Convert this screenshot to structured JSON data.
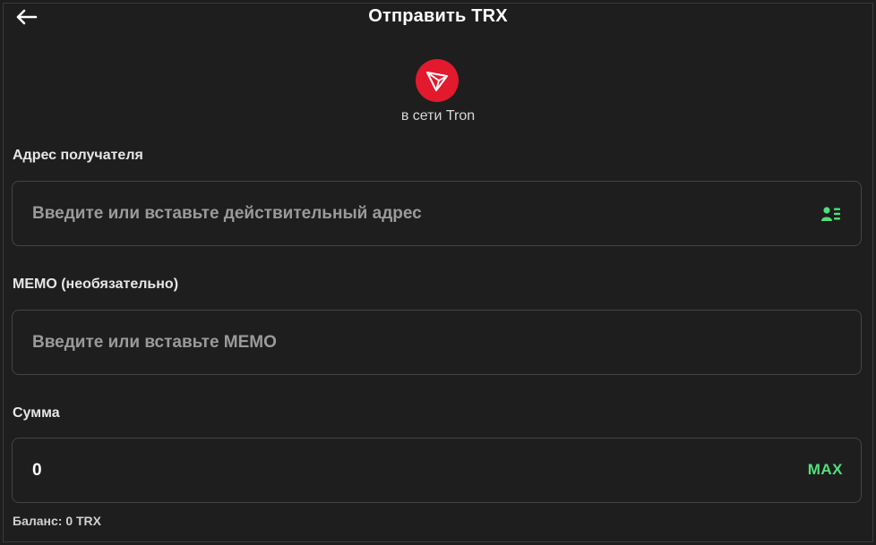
{
  "header": {
    "title": "Отправить TRX",
    "back_icon": "arrow-left-icon"
  },
  "coin": {
    "logo_icon": "tron-logo-icon",
    "network_label": "в сети Tron",
    "brand_color": "#e3192e"
  },
  "recipient": {
    "label": "Адрес получателя",
    "placeholder": "Введите или вставьте действительный адрес",
    "value": "",
    "icon": "address-book-icon"
  },
  "memo": {
    "label": "MEMO (необязательно)",
    "placeholder": "Введите или вставьте MEMO",
    "value": ""
  },
  "amount": {
    "label": "Сумма",
    "value": "0",
    "max_label": "MAX"
  },
  "balance": {
    "text": "Баланс: 0 TRX"
  },
  "colors": {
    "background": "#1e1e1e",
    "accent": "#4fe07a",
    "border": "#444444"
  }
}
